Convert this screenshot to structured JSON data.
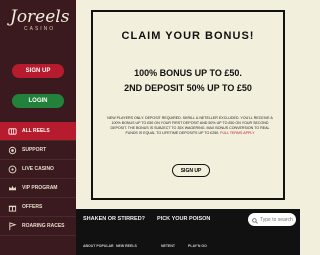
{
  "brand": {
    "name": "Joreels",
    "sub": "CASINO"
  },
  "sidebar": {
    "signup_label": "SIGN UP",
    "login_label": "LOGIN",
    "items": [
      {
        "label": "ALL REELS",
        "icon": "slot-icon"
      },
      {
        "label": "SUPPORT",
        "icon": "support-icon"
      },
      {
        "label": "LIVE CASINO",
        "icon": "live-casino-icon"
      },
      {
        "label": "VIP PROGRAM",
        "icon": "crown-icon"
      },
      {
        "label": "OFFERS",
        "icon": "gift-icon"
      },
      {
        "label": "ROARING RACES",
        "icon": "races-icon"
      }
    ]
  },
  "bonus": {
    "title": "CLAIM YOUR BONUS!",
    "line1": "100% BONUS UP TO £50.",
    "line2": "2ND DEPOSIT 50% UP TO £50",
    "terms": "NEW PLAYERS ONLY. DEPOSIT REQUIRED. SKRILL & NETELLER EXCLUDED. YOU'LL RECEIVE A 100% BONUS UP TO £50 ON YOUR FIRST DEPOSIT AND 50% UP TO £50 ON YOUR SECOND DEPOSIT. THE BONUS IS SUBJECT TO 35X WAGERING. MAX BONUS CONVERSION TO REAL FUNDS IS EQUAL TO LIFETIME DEPOSITS UP TO £250.",
    "terms_link": "FULL TERMS APPLY",
    "button_label": "SIGN UP"
  },
  "footer": {
    "heading1": "SHAKEN OR STIRRED?",
    "heading2": "PICK YOUR POISON",
    "search_placeholder": "Type to search",
    "links": [
      "ABOUT POPULAR",
      "NEW REELS",
      "NETENT",
      "PLAY'N GO"
    ]
  },
  "colors": {
    "sidebar": "#3a1a1e",
    "accent_red": "#b71c2e",
    "accent_green": "#22823b",
    "cream": "#f2efdc"
  }
}
